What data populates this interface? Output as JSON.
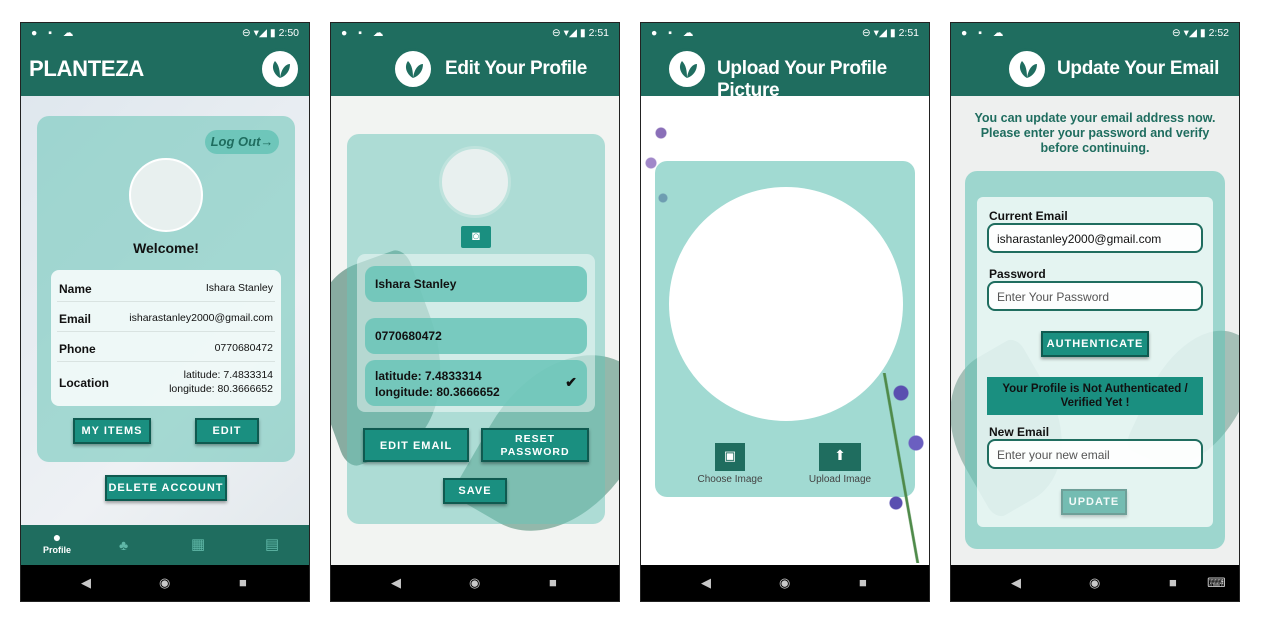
{
  "status": [
    {
      "time": "2:50"
    },
    {
      "time": "2:51"
    },
    {
      "time": "2:51"
    },
    {
      "time": "2:52"
    }
  ],
  "screen1": {
    "app_title": "PLANTEZA",
    "logout": "Log Out→",
    "welcome": "Welcome!",
    "rows": [
      {
        "key": "Name",
        "value": "Ishara Stanley"
      },
      {
        "key": "Email",
        "value": "isharastanley2000@gmail.com"
      },
      {
        "key": "Phone",
        "value": "0770680472"
      },
      {
        "key": "Location",
        "value1": "latitude: 7.4833314",
        "value2": "longitude: 80.3666652"
      }
    ],
    "my_items": "MY ITEMS",
    "edit": "EDIT",
    "delete_account": "DELETE ACCOUNT",
    "tab_profile": "Profile"
  },
  "screen2": {
    "title": "Edit Your Profile",
    "name": "Ishara Stanley",
    "phone": "0770680472",
    "lat": "latitude: 7.4833314",
    "lon": "longitude: 80.3666652",
    "edit_email": "EDIT EMAIL",
    "reset_password_1": "RESET",
    "reset_password_2": "PASSWORD",
    "save": "SAVE"
  },
  "screen3": {
    "title": "Upload Your Profile Picture",
    "choose_image": "Choose Image",
    "upload_image": "Upload Image"
  },
  "screen4": {
    "title": "Update Your Email",
    "intro": "You can update your email address now. Please enter your password and verify before continuing.",
    "current_email_label": "Current Email",
    "current_email_value": "isharastanley2000@gmail.com",
    "password_label": "Password",
    "password_placeholder": "Enter Your Password",
    "authenticate": "AUTHENTICATE",
    "not_auth": "Your Profile is Not Authenticated / Verified Yet !",
    "new_email_label": "New Email",
    "new_email_placeholder": "Enter your new email",
    "update": "UPDATE"
  },
  "colors": {
    "primary": "#1f6d5f",
    "accent": "#1a8f80",
    "card": "#68c4b7"
  }
}
